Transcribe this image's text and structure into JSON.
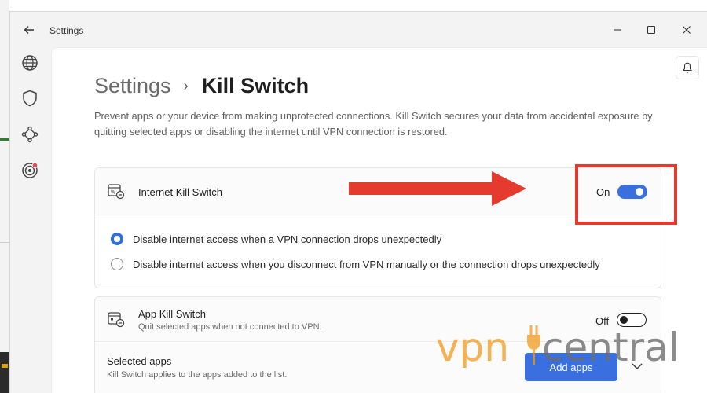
{
  "window": {
    "title": "Settings"
  },
  "breadcrumb": {
    "parent": "Settings",
    "separator": "›",
    "current": "Kill Switch"
  },
  "description": "Prevent apps or your device from making unprotected connections. Kill Switch secures your data from accidental exposure by quitting selected apps or disabling the internet until VPN connection is restored.",
  "internet_kill_switch": {
    "title": "Internet Kill Switch",
    "toggle_label": "On",
    "toggle_on": true,
    "options": [
      {
        "label": "Disable internet access when a VPN connection drops unexpectedly",
        "selected": true
      },
      {
        "label": "Disable internet access when you disconnect from VPN manually or the connection drops unexpectedly",
        "selected": false
      }
    ]
  },
  "app_kill_switch": {
    "title": "App Kill Switch",
    "subtitle": "Quit selected apps when not connected to VPN.",
    "toggle_label": "Off",
    "toggle_on": false,
    "selected_apps_title": "Selected apps",
    "selected_apps_subtitle": "Kill Switch applies to the apps added to the list.",
    "add_button": "Add apps"
  },
  "watermark": {
    "text": "vpncentral",
    "brand_orange": "#f39a1e",
    "brand_gray": "#6e6e6e"
  },
  "colors": {
    "accent": "#3a6fe0",
    "annotation_red": "#e53b2f"
  },
  "icons": [
    "back-arrow-icon",
    "minimize-icon",
    "maximize-icon",
    "close-icon",
    "globe-icon",
    "shield-icon",
    "network-nodes-icon",
    "target-icon",
    "bell-icon",
    "internet-kill-switch-icon",
    "app-kill-switch-icon",
    "chevron-down-icon"
  ]
}
